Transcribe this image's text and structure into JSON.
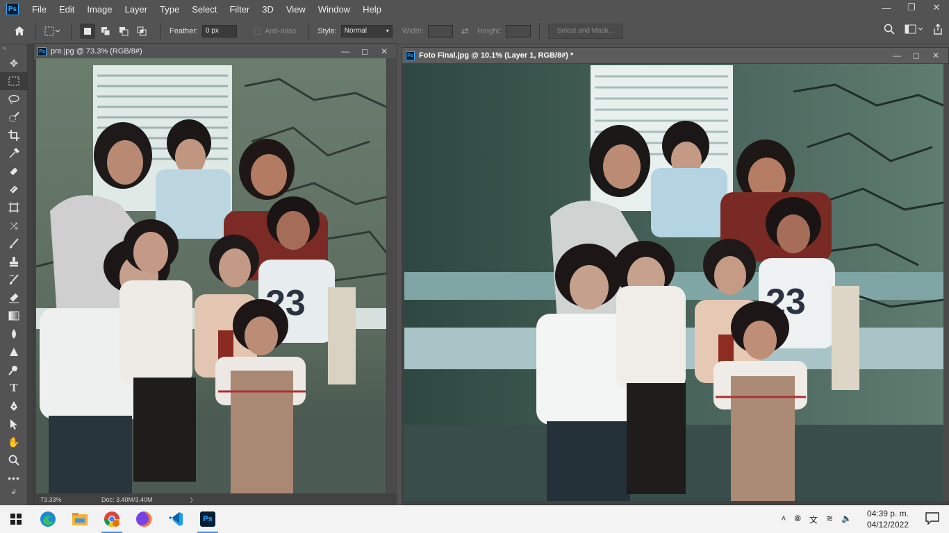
{
  "app": {
    "logo": "Ps"
  },
  "menu": [
    "File",
    "Edit",
    "Image",
    "Layer",
    "Type",
    "Select",
    "Filter",
    "3D",
    "View",
    "Window",
    "Help"
  ],
  "window_controls": {
    "minimize": "—",
    "restore": "❐",
    "close": "✕"
  },
  "options": {
    "feather_label": "Feather:",
    "feather_value": "0 px",
    "antialias_label": "Anti-alias",
    "style_label": "Style:",
    "style_value": "Normal",
    "width_label": "Width:",
    "height_label": "Height:",
    "mask_button": "Select and Mask..."
  },
  "tools": [
    "move-icon",
    "marquee-icon",
    "lasso-icon",
    "quick-select-icon",
    "crop-icon",
    "eyedropper-icon",
    "healing-icon",
    "brush-icon",
    "clone-stamp-icon",
    "history-brush-icon",
    "eraser-icon",
    "gradient-icon",
    "blur-icon",
    "dodge-icon",
    "pen-icon",
    "type-icon",
    "path-select-icon",
    "shape-icon",
    "hand-icon",
    "zoom-icon",
    "more-icon"
  ],
  "doc_left": {
    "title": "pre.jpg @ 73.3% (RGB/8#)",
    "zoom": "73.33%",
    "docsize": "Doc: 3.40M/3.40M"
  },
  "doc_right": {
    "title": "Foto Final.jpg @ 10.1% (Layer 1, RGB/8#) *"
  },
  "taskbar": {
    "apps": [
      "windows-start-icon",
      "edge-icon",
      "file-explorer-icon",
      "chrome-icon",
      "firefox-icon",
      "vscode-icon",
      "photoshop-icon"
    ],
    "time": "04:39 p. m.",
    "date": "04/12/2022"
  },
  "colors": {
    "accent": "#31a8ff",
    "panel": "#535353",
    "canvas_bg": "#424242"
  }
}
